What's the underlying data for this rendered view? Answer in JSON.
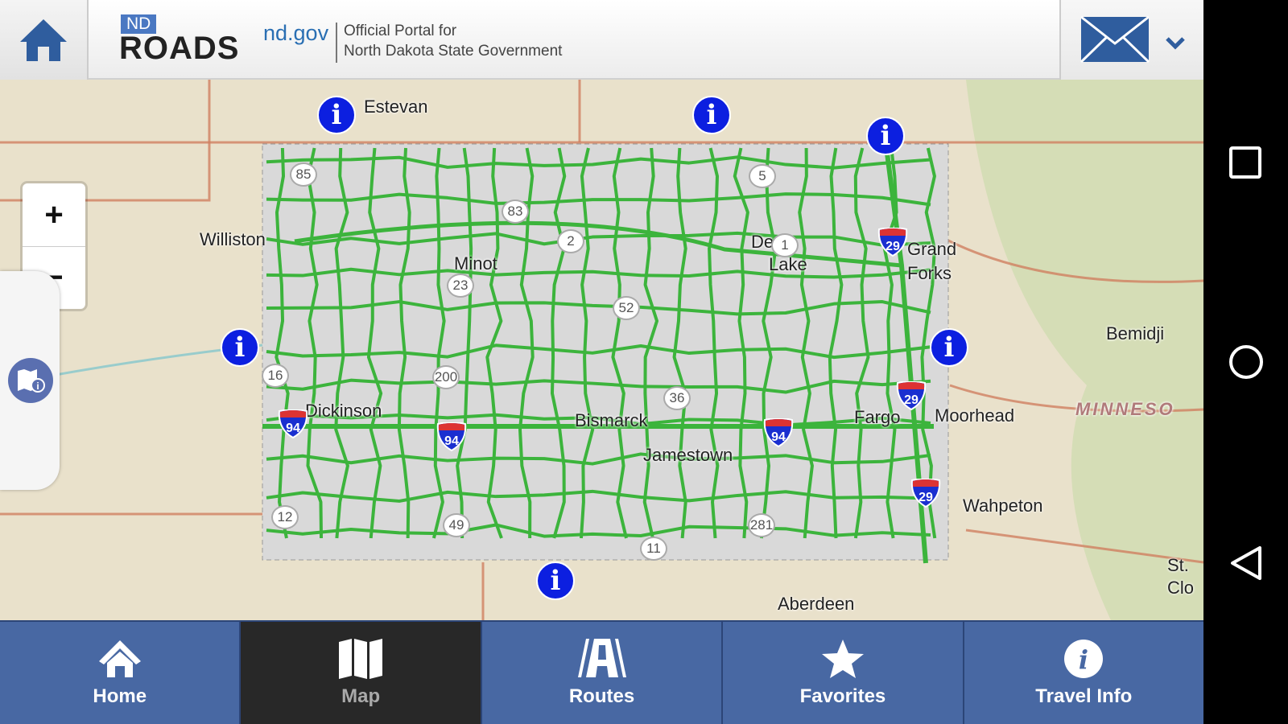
{
  "header": {
    "logo_nd": "ND",
    "logo_roads": "ROADS",
    "ndgov": "nd.gov",
    "portal_line1": "Official Portal for",
    "portal_line2": "North Dakota State Government"
  },
  "map": {
    "zoom_in": "+",
    "zoom_out": "−",
    "cities": [
      "Estevan",
      "Williston",
      "Minot",
      "De",
      "Lake",
      "Grand",
      "Forks",
      "Bemidji",
      "Dickinson",
      "Bismarck",
      "Jamestown",
      "Fargo",
      "Moorhead",
      "Wahpeton",
      "Aberdeen",
      "St.",
      "Clo",
      "MINNESO"
    ],
    "state_routes": [
      "85",
      "83",
      "2",
      "5",
      "1",
      "23",
      "52",
      "16",
      "200",
      "36",
      "12",
      "49",
      "281",
      "11"
    ],
    "interstates": [
      "94",
      "94",
      "94",
      "29",
      "29",
      "29"
    ],
    "info_marker_label": "i",
    "colors": {
      "roads": "#3cb43c",
      "state": "#d9d9d9",
      "info": "#0c1fe0",
      "base": "#e9e1cb"
    }
  },
  "nav": {
    "tabs": [
      {
        "label": "Home",
        "icon": "home-icon"
      },
      {
        "label": "Map",
        "icon": "map-icon",
        "active": true
      },
      {
        "label": "Routes",
        "icon": "road-icon"
      },
      {
        "label": "Favorites",
        "icon": "star-icon"
      },
      {
        "label": "Travel Info",
        "icon": "info-icon"
      }
    ]
  }
}
